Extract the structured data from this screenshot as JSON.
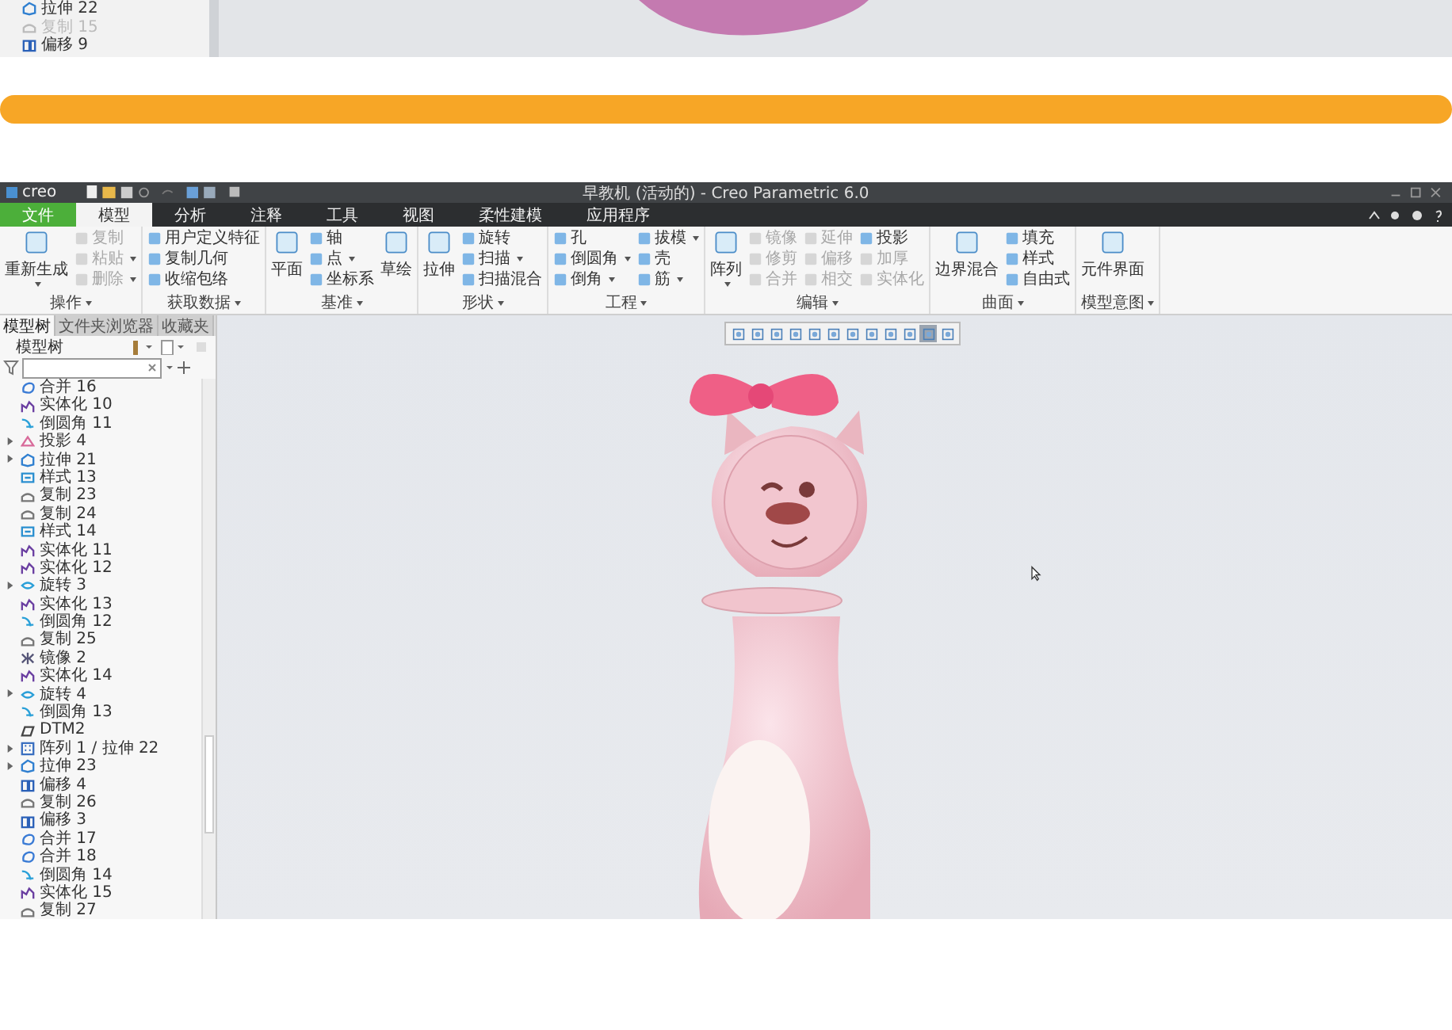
{
  "previous_frame": {
    "tree_items": [
      {
        "label": "拉伸 22",
        "kind": "extrude",
        "dimmed": false
      },
      {
        "label": "复制 15",
        "kind": "copy",
        "dimmed": true
      },
      {
        "label": "偏移 9",
        "kind": "offset",
        "dimmed": false
      }
    ]
  },
  "window": {
    "title": "早教机 (活动的) - Creo Parametric 6.0",
    "logo": "creo"
  },
  "tabs": [
    {
      "label": "文件",
      "kind": "file",
      "selected": false
    },
    {
      "label": "模型",
      "kind": "tab",
      "selected": true
    },
    {
      "label": "分析",
      "kind": "tab",
      "selected": false
    },
    {
      "label": "注释",
      "kind": "tab",
      "selected": false
    },
    {
      "label": "工具",
      "kind": "tab",
      "selected": false
    },
    {
      "label": "视图",
      "kind": "tab",
      "selected": false
    },
    {
      "label": "柔性建模",
      "kind": "tab",
      "selected": false
    },
    {
      "label": "应用程序",
      "kind": "tab",
      "selected": false
    }
  ],
  "ribbon": [
    {
      "label": "操作",
      "items": [
        {
          "kind": "big",
          "label": "重新生成",
          "dropdown": true
        },
        {
          "kind": "column",
          "entries": [
            {
              "label": "复制",
              "disabled": true,
              "dropdown": false
            },
            {
              "label": "粘贴",
              "disabled": true,
              "dropdown": true
            },
            {
              "label": "删除",
              "disabled": true,
              "dropdown": true
            }
          ]
        }
      ]
    },
    {
      "label": "获取数据",
      "items": [
        {
          "kind": "column",
          "entries": [
            {
              "label": "用户定义特征",
              "disabled": false,
              "dropdown": false
            },
            {
              "label": "复制几何",
              "disabled": false,
              "dropdown": false
            },
            {
              "label": "收缩包络",
              "disabled": false,
              "dropdown": false
            }
          ]
        }
      ]
    },
    {
      "label": "基准",
      "items": [
        {
          "kind": "big",
          "label": "平面",
          "dropdown": false
        },
        {
          "kind": "column",
          "entries": [
            {
              "label": "轴",
              "disabled": false,
              "dropdown": false
            },
            {
              "label": "点",
              "disabled": false,
              "dropdown": true
            },
            {
              "label": "坐标系",
              "disabled": false,
              "dropdown": false
            }
          ]
        },
        {
          "kind": "big",
          "label": "草绘",
          "dropdown": false
        }
      ]
    },
    {
      "label": "形状",
      "items": [
        {
          "kind": "big",
          "label": "拉伸",
          "dropdown": false
        },
        {
          "kind": "column",
          "entries": [
            {
              "label": "旋转",
              "disabled": false,
              "dropdown": false
            },
            {
              "label": "扫描",
              "disabled": false,
              "dropdown": true
            },
            {
              "label": "扫描混合",
              "disabled": false,
              "dropdown": false
            }
          ]
        }
      ]
    },
    {
      "label": "工程",
      "items": [
        {
          "kind": "column",
          "entries": [
            {
              "label": "孔",
              "disabled": false,
              "dropdown": false
            },
            {
              "label": "倒圆角",
              "disabled": false,
              "dropdown": true
            },
            {
              "label": "倒角",
              "disabled": false,
              "dropdown": true
            }
          ]
        },
        {
          "kind": "column",
          "entries": [
            {
              "label": "拔模",
              "disabled": false,
              "dropdown": true
            },
            {
              "label": "壳",
              "disabled": false,
              "dropdown": false
            },
            {
              "label": "筋",
              "disabled": false,
              "dropdown": true
            }
          ]
        }
      ]
    },
    {
      "label": "编辑",
      "items": [
        {
          "kind": "big",
          "label": "阵列",
          "dropdown": true
        },
        {
          "kind": "column",
          "entries": [
            {
              "label": "镜像",
              "disabled": true,
              "dropdown": false
            },
            {
              "label": "修剪",
              "disabled": true,
              "dropdown": false
            },
            {
              "label": "合并",
              "disabled": true,
              "dropdown": false
            }
          ]
        },
        {
          "kind": "column",
          "entries": [
            {
              "label": "延伸",
              "disabled": true,
              "dropdown": false
            },
            {
              "label": "偏移",
              "disabled": true,
              "dropdown": false
            },
            {
              "label": "相交",
              "disabled": true,
              "dropdown": false
            }
          ]
        },
        {
          "kind": "column",
          "entries": [
            {
              "label": "投影",
              "disabled": false,
              "dropdown": false
            },
            {
              "label": "加厚",
              "disabled": true,
              "dropdown": false
            },
            {
              "label": "实体化",
              "disabled": true,
              "dropdown": false
            }
          ]
        }
      ]
    },
    {
      "label": "曲面",
      "items": [
        {
          "kind": "big",
          "label": "边界混合",
          "dropdown": false
        },
        {
          "kind": "column",
          "entries": [
            {
              "label": "填充",
              "disabled": false,
              "dropdown": false
            },
            {
              "label": "样式",
              "disabled": false,
              "dropdown": false
            },
            {
              "label": "自由式",
              "disabled": false,
              "dropdown": false
            }
          ]
        }
      ]
    },
    {
      "label": "模型意图",
      "items": [
        {
          "kind": "big",
          "label": "元件界面",
          "dropdown": false
        }
      ]
    }
  ],
  "view_toolbar": [
    {
      "selected": false
    },
    {
      "selected": false
    },
    {
      "selected": false
    },
    {
      "selected": false
    },
    {
      "selected": false
    },
    {
      "selected": false
    },
    {
      "selected": false
    },
    {
      "selected": false
    },
    {
      "selected": false
    },
    {
      "selected": false
    },
    {
      "selected": true
    },
    {
      "selected": false
    }
  ],
  "panel_tabs": [
    {
      "label": "模型树",
      "selected": true
    },
    {
      "label": "文件夹浏览器",
      "selected": false
    },
    {
      "label": "收藏夹",
      "selected": false
    }
  ],
  "model_tree": {
    "title": "模型树",
    "items": [
      {
        "label": "合并 16",
        "kind": "merge",
        "expandable": false
      },
      {
        "label": "实体化 10",
        "kind": "solidify",
        "expandable": false
      },
      {
        "label": "倒圆角 11",
        "kind": "round",
        "expandable": false
      },
      {
        "label": "投影 4",
        "kind": "project",
        "expandable": true
      },
      {
        "label": "拉伸 21",
        "kind": "extrude",
        "expandable": true
      },
      {
        "label": "样式 13",
        "kind": "style",
        "expandable": false
      },
      {
        "label": "复制 23",
        "kind": "copy",
        "expandable": false
      },
      {
        "label": "复制 24",
        "kind": "copy",
        "expandable": false
      },
      {
        "label": "样式 14",
        "kind": "style",
        "expandable": false
      },
      {
        "label": "实体化 11",
        "kind": "solidify",
        "expandable": false
      },
      {
        "label": "实体化 12",
        "kind": "solidify",
        "expandable": false
      },
      {
        "label": "旋转 3",
        "kind": "revolve",
        "expandable": true
      },
      {
        "label": "实体化 13",
        "kind": "solidify",
        "expandable": false
      },
      {
        "label": "倒圆角 12",
        "kind": "round",
        "expandable": false
      },
      {
        "label": "复制 25",
        "kind": "copy",
        "expandable": false
      },
      {
        "label": "镜像 2",
        "kind": "mirror",
        "expandable": false
      },
      {
        "label": "实体化 14",
        "kind": "solidify",
        "expandable": false
      },
      {
        "label": "旋转 4",
        "kind": "revolve",
        "expandable": true
      },
      {
        "label": "倒圆角 13",
        "kind": "round",
        "expandable": false
      },
      {
        "label": "DTM2",
        "kind": "datum",
        "expandable": false
      },
      {
        "label": "阵列 1 / 拉伸 22",
        "kind": "pattern",
        "expandable": true
      },
      {
        "label": "拉伸 23",
        "kind": "extrude",
        "expandable": true
      },
      {
        "label": "偏移 4",
        "kind": "offset",
        "expandable": false
      },
      {
        "label": "复制 26",
        "kind": "copy",
        "expandable": false
      },
      {
        "label": "偏移 3",
        "kind": "offset",
        "expandable": false
      },
      {
        "label": "合并 17",
        "kind": "merge",
        "expandable": false
      },
      {
        "label": "合并 18",
        "kind": "merge",
        "expandable": false
      },
      {
        "label": "倒圆角 14",
        "kind": "round",
        "expandable": false
      },
      {
        "label": "实体化 15",
        "kind": "solidify",
        "expandable": false
      },
      {
        "label": "复制 27",
        "kind": "copy",
        "expandable": false
      }
    ]
  }
}
